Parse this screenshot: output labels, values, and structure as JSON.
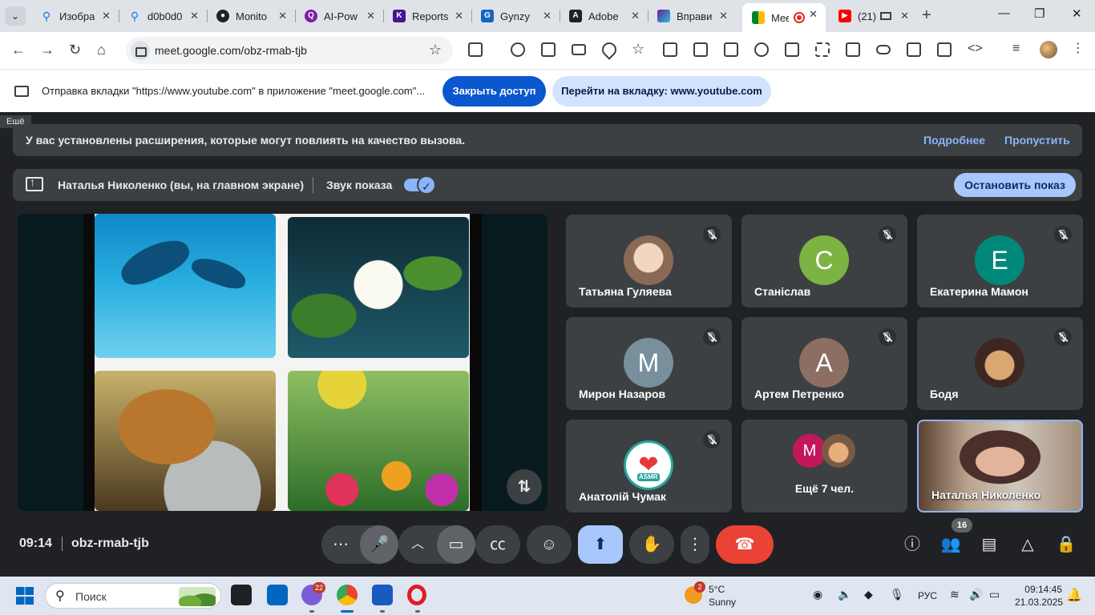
{
  "browser": {
    "tabs": [
      {
        "title": "Изобра",
        "color": "#1a73e8",
        "icon": "search-icon"
      },
      {
        "title": "d0b0d0",
        "color": "#1a73e8",
        "icon": "search-icon"
      },
      {
        "title": "Monito",
        "color": "#202124",
        "icon": "app-icon"
      },
      {
        "title": "AI-Pow",
        "color": "#7b1fa2",
        "icon": "q-icon"
      },
      {
        "title": "Reports",
        "color": "#4a148c",
        "icon": "k-icon"
      },
      {
        "title": "Gynzy",
        "color": "#1565c0",
        "icon": "g-icon"
      },
      {
        "title": "Adobe",
        "color": "#202124",
        "icon": "adobe-icon"
      },
      {
        "title": "Вправи",
        "color": "#6a1b9a",
        "icon": "puzzle-icon"
      },
      {
        "title": "Mee",
        "color": "#00832d",
        "icon": "meet-icon"
      },
      {
        "title": "(21)",
        "color": "#ff0000",
        "icon": "youtube-icon"
      }
    ],
    "new_tab": "+",
    "url": "meet.google.com/obz-rmab-tjb",
    "infobar_message": "Отправка вкладки \"https://www.youtube.com\" в приложение \"meet.google.com\"...",
    "stop_access_label": "Закрыть доступ",
    "switch_tab_label": "Перейти на вкладку: www.youtube.com"
  },
  "meet": {
    "more_tooltip": "Ещё",
    "banner_text": "У вас установлены расширения, которые могут повлиять на качество вызова.",
    "banner_more": "Подробнее",
    "banner_skip": "Пропустить",
    "presenter": "Наталья Николенко (вы, на главном экране)",
    "sound_label": "Звук показа",
    "stop_sharing": "Остановить показ",
    "participants": [
      {
        "name": "Татьяна Гуляева",
        "avatar_letter": "",
        "avatar_color": "#b79a84",
        "muted": true
      },
      {
        "name": "Станіслав",
        "avatar_letter": "С",
        "avatar_color": "#7cb342",
        "muted": true
      },
      {
        "name": "Екатерина Мамон",
        "avatar_letter": "Е",
        "avatar_color": "#00897b",
        "muted": true
      },
      {
        "name": "Мирон Назаров",
        "avatar_letter": "М",
        "avatar_color": "#78909c",
        "muted": true
      },
      {
        "name": "Артем Петренко",
        "avatar_letter": "А",
        "avatar_color": "#8d6e63",
        "muted": true
      },
      {
        "name": "Бодя",
        "avatar_letter": "",
        "avatar_color": "#3e2723",
        "muted": true
      },
      {
        "name": "Анатолій Чумак",
        "avatar_letter": "ASMR",
        "avatar_color": "#ffffff",
        "muted": true
      },
      {
        "name": "Наталья Николенко",
        "avatar_letter": "",
        "avatar_color": "",
        "muted": false
      }
    ],
    "more_people": "Ещё 7 чел.",
    "more_people_avatar": "M",
    "time": "09:14",
    "meeting_code": "obz-rmab-tjb",
    "participant_count": "16"
  },
  "taskbar": {
    "search_label": "Поиск",
    "notification_count": "22",
    "weather_badge": "2",
    "temperature": "5°C",
    "weather": "Sunny",
    "language": "РУС",
    "time": "09:14:45",
    "date": "21.03.2025"
  }
}
